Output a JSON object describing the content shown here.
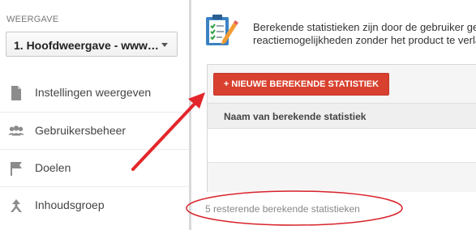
{
  "sidebar": {
    "view_label": "WEERGAVE",
    "view_select_value": "1. Hoofdweergave - www…",
    "items": [
      {
        "label": "Instellingen weergeven",
        "icon": "document-icon"
      },
      {
        "label": "Gebruikersbeheer",
        "icon": "users-icon"
      },
      {
        "label": "Doelen",
        "icon": "flag-icon"
      },
      {
        "label": "Inhoudsgroep",
        "icon": "content-grouping-icon"
      }
    ]
  },
  "main": {
    "intro_icon": "clipboard-pencil-icon",
    "intro_line_1": "Berekende statistieken zijn door de gebruiker ge",
    "intro_line_2": "reactiemogelijkheden zonder het product te verla",
    "new_button_label": "+ NIEUWE BEREKENDE STATISTIEK",
    "table_header": "Naam van berekende statistiek",
    "remaining_text": "5 resterende berekende statistieken"
  },
  "annotation": {
    "arrow_color": "#e3262a",
    "ellipse_color": "#d8232a"
  },
  "colors": {
    "button_red": "#d8412f",
    "sidebar_divider": "#d9d9d9",
    "icon_gray": "#8c8c8c"
  }
}
